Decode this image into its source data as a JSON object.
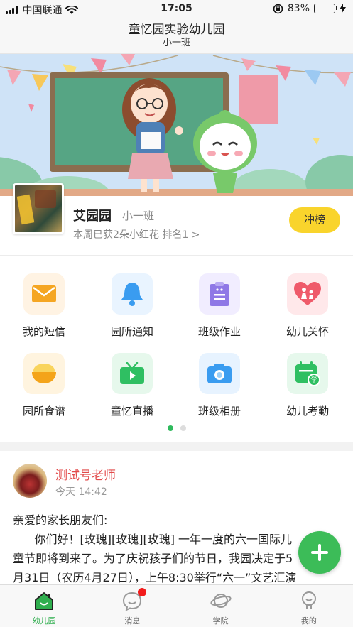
{
  "status_bar": {
    "carrier": "中国联通",
    "time": "17:05",
    "battery_percent": "83%",
    "battery_level": 0.83
  },
  "header": {
    "title": "童忆园实验幼儿园",
    "subtitle": "小一班"
  },
  "profile": {
    "name": "艾园园",
    "class_name": "小一班",
    "description": "本周已获2朵小红花 排名1  >",
    "rank_button": "冲榜"
  },
  "grid": {
    "items": [
      {
        "label": "我的短信",
        "icon": "envelope-icon",
        "bg": "#fff3e3",
        "color": "#f5a623"
      },
      {
        "label": "园所通知",
        "icon": "bell-icon",
        "bg": "#e9f4ff",
        "color": "#3a9cf0"
      },
      {
        "label": "班级作业",
        "icon": "clipboard-icon",
        "bg": "#f1edff",
        "color": "#8f78e6"
      },
      {
        "label": "幼儿关怀",
        "icon": "heart-family-icon",
        "bg": "#ffe8ea",
        "color": "#ef5a6a"
      },
      {
        "label": "园所食谱",
        "icon": "rice-bowl-icon",
        "bg": "#fff4df",
        "color": "#f4b51a"
      },
      {
        "label": "童忆直播",
        "icon": "tv-icon",
        "bg": "#e6f8ec",
        "color": "#2fbf62"
      },
      {
        "label": "班级相册",
        "icon": "camera-icon",
        "bg": "#e7f3ff",
        "color": "#3a9cf0"
      },
      {
        "label": "幼儿考勤",
        "icon": "calendar-study-icon",
        "bg": "#e6f8ec",
        "color": "#2fbf62"
      }
    ]
  },
  "post": {
    "author": "测试号老师",
    "time": "今天 14:42",
    "body": "亲爱的家长朋友们:\n      你们好！[玫瑰][玫瑰][玫瑰] 一年一度的六一国际儿\n童节即将到来了。为了庆祝孩子们的节日，我园决定于5\n月31日（农历4月27日），上午8:30举行“六一”文艺汇演"
  },
  "tabbar": {
    "tabs": [
      {
        "label": "幼儿园",
        "icon": "house-icon",
        "active": true
      },
      {
        "label": "消息",
        "icon": "chat-bubble-icon",
        "active": false
      },
      {
        "label": "学院",
        "icon": "planet-icon",
        "active": false
      },
      {
        "label": "我的",
        "icon": "person-icon",
        "active": false
      }
    ]
  },
  "colors": {
    "accent_green": "#2fae4e",
    "rank_yellow": "#f9d42c",
    "author_red": "#e24a4a"
  }
}
